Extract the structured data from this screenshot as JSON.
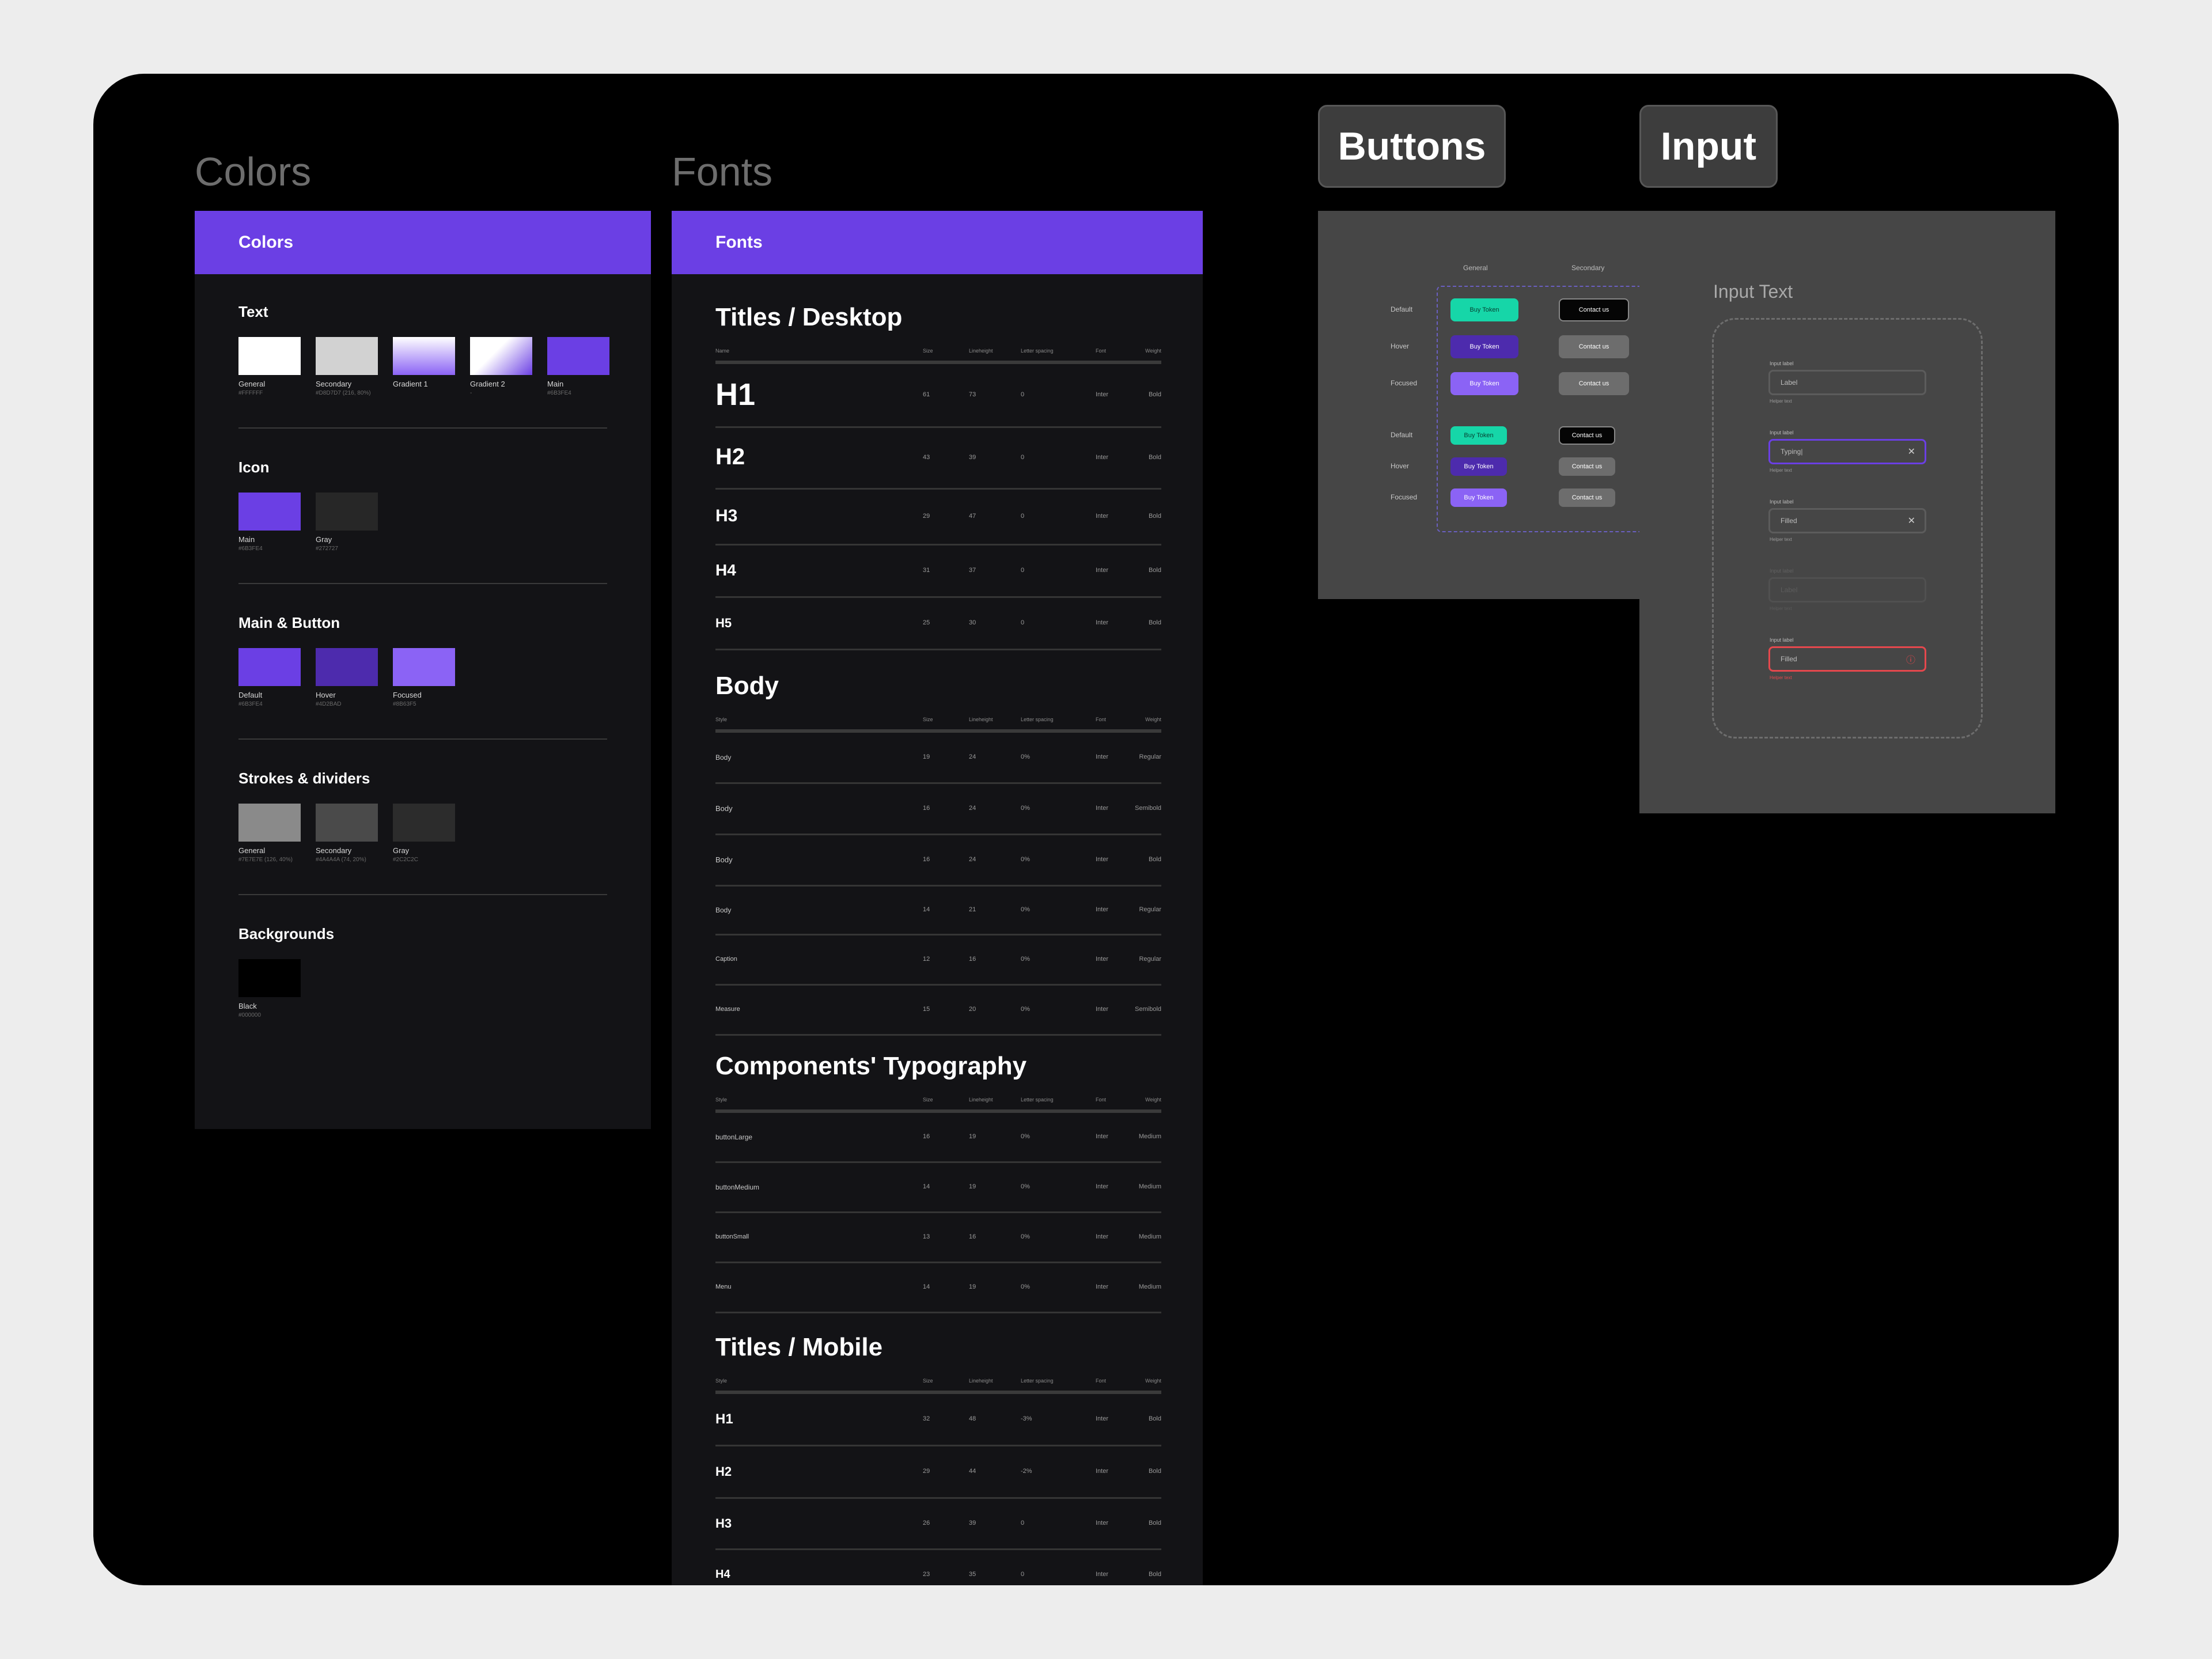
{
  "sections": {
    "colors": "Colors",
    "fonts": "Fonts",
    "buttons": "Buttons",
    "input": "Input"
  },
  "colors_frame": {
    "header": "Colors",
    "groups": [
      {
        "title": "Text",
        "swatches": [
          {
            "name": "General",
            "hex": "#FFFFFF",
            "color": "#ffffff"
          },
          {
            "name": "Secondary",
            "hex": "#D8D7D7 (216, 80%)",
            "color": "#d2d2d2"
          },
          {
            "name": "Gradient 1",
            "hex": "",
            "color": "linear-gradient(180deg,#ffffff 0%,#8b63f5 100%)"
          },
          {
            "name": "Gradient 2",
            "hex": "-",
            "color": "linear-gradient(135deg,#ffffff 0%,#ffffff 40%,#6b3fe4 100%)"
          },
          {
            "name": "Main",
            "hex": "#6B3FE4",
            "color": "#6b3fe4"
          }
        ]
      },
      {
        "title": "Icon",
        "swatches": [
          {
            "name": "Main",
            "hex": "#6B3FE4",
            "color": "#6b3fe4"
          },
          {
            "name": "Gray",
            "hex": "#272727",
            "color": "#272727"
          }
        ]
      },
      {
        "title": "Main & Button",
        "swatches": [
          {
            "name": "Default",
            "hex": "#6B3FE4",
            "color": "#6b3fe4"
          },
          {
            "name": "Hover",
            "hex": "#4D2BAD",
            "color": "#4d2bad"
          },
          {
            "name": "Focused",
            "hex": "#8B63F5",
            "color": "#8b63f5"
          }
        ]
      },
      {
        "title": "Strokes & dividers",
        "swatches": [
          {
            "name": "General",
            "hex": "#7E7E7E (126, 40%)",
            "color": "#8a8a8a"
          },
          {
            "name": "Secondary",
            "hex": "#4A4A4A (74, 20%)",
            "color": "#4a4a4a"
          },
          {
            "name": "Gray",
            "hex": "#2C2C2C",
            "color": "#2c2c2c"
          }
        ]
      },
      {
        "title": "Backgrounds",
        "swatches": [
          {
            "name": "Black",
            "hex": "#000000",
            "color": "#000000"
          }
        ]
      }
    ]
  },
  "fonts_frame": {
    "header": "Fonts",
    "sections": [
      {
        "title": "Titles / Desktop",
        "headers": [
          "Name",
          "Size",
          "Lineheight",
          "Letter spacing",
          "Font",
          "Weight"
        ],
        "rows": [
          {
            "name": "H1",
            "size": "61",
            "lh": "73",
            "ls": "0",
            "font": "Inter",
            "weight": "Bold"
          },
          {
            "name": "H2",
            "size": "43",
            "lh": "39",
            "ls": "0",
            "font": "Inter",
            "weight": "Bold"
          },
          {
            "name": "H3",
            "size": "29",
            "lh": "47",
            "ls": "0",
            "font": "Inter",
            "weight": "Bold"
          },
          {
            "name": "H4",
            "size": "31",
            "lh": "37",
            "ls": "0",
            "font": "Inter",
            "weight": "Bold"
          },
          {
            "name": "H5",
            "size": "25",
            "lh": "30",
            "ls": "0",
            "font": "Inter",
            "weight": "Bold"
          }
        ]
      },
      {
        "title": "Body",
        "headers": [
          "Style",
          "Size",
          "Lineheight",
          "Letter spacing",
          "Font",
          "Weight"
        ],
        "rows": [
          {
            "name": "Body",
            "size": "19",
            "lh": "24",
            "ls": "0%",
            "font": "Inter",
            "weight": "Regular"
          },
          {
            "name": "Body",
            "size": "16",
            "lh": "24",
            "ls": "0%",
            "font": "Inter",
            "weight": "Semibold"
          },
          {
            "name": "Body",
            "size": "16",
            "lh": "24",
            "ls": "0%",
            "font": "Inter",
            "weight": "Bold"
          },
          {
            "name": "Body",
            "size": "14",
            "lh": "21",
            "ls": "0%",
            "font": "Inter",
            "weight": "Regular"
          },
          {
            "name": "Caption",
            "size": "12",
            "lh": "16",
            "ls": "0%",
            "font": "Inter",
            "weight": "Regular"
          },
          {
            "name": "Measure",
            "size": "15",
            "lh": "20",
            "ls": "0%",
            "font": "Inter",
            "weight": "Semibold"
          }
        ]
      },
      {
        "title": "Components' Typography",
        "headers": [
          "Style",
          "Size",
          "Lineheight",
          "Letter spacing",
          "Font",
          "Weight"
        ],
        "rows": [
          {
            "name": "buttonLarge",
            "size": "16",
            "lh": "19",
            "ls": "0%",
            "font": "Inter",
            "weight": "Medium"
          },
          {
            "name": "buttonMedium",
            "size": "14",
            "lh": "19",
            "ls": "0%",
            "font": "Inter",
            "weight": "Medium"
          },
          {
            "name": "buttonSmall",
            "size": "13",
            "lh": "16",
            "ls": "0%",
            "font": "Inter",
            "weight": "Medium"
          },
          {
            "name": "Menu",
            "size": "14",
            "lh": "19",
            "ls": "0%",
            "font": "Inter",
            "weight": "Medium"
          }
        ]
      },
      {
        "title": "Titles / Mobile",
        "headers": [
          "Style",
          "Size",
          "Lineheight",
          "Letter spacing",
          "Font",
          "Weight"
        ],
        "rows": [
          {
            "name": "H1",
            "size": "32",
            "lh": "48",
            "ls": "-3%",
            "font": "Inter",
            "weight": "Bold"
          },
          {
            "name": "H2",
            "size": "29",
            "lh": "44",
            "ls": "-2%",
            "font": "Inter",
            "weight": "Bold"
          },
          {
            "name": "H3",
            "size": "26",
            "lh": "39",
            "ls": "0",
            "font": "Inter",
            "weight": "Bold"
          },
          {
            "name": "H4",
            "size": "23",
            "lh": "35",
            "ls": "0",
            "font": "Inter",
            "weight": "Bold"
          }
        ]
      }
    ]
  },
  "buttons_frame": {
    "col_general": "General",
    "col_secondary": "Secondary",
    "rows_large": [
      "Default",
      "Hover",
      "Focused"
    ],
    "rows_small": [
      "Default",
      "Hover",
      "Focused"
    ],
    "primary_label": "Buy Token",
    "secondary_label": "Contact us",
    "colors": {
      "default": "#16d6a8",
      "hover": "#4d2bad",
      "focused": "#8b63f5",
      "secondary_default": "#050505",
      "secondary_other": "#6d6d6d"
    }
  },
  "input_frame": {
    "title": "Input Text",
    "fields": [
      {
        "label": "Input label",
        "value": "Label",
        "helper": "Helper text",
        "state": "default",
        "icon": ""
      },
      {
        "label": "Input label",
        "value": "Typing|",
        "helper": "Helper text",
        "state": "focused",
        "icon": "✕"
      },
      {
        "label": "Input label",
        "value": "Filled",
        "helper": "Helper text",
        "state": "filled",
        "icon": "✕"
      },
      {
        "label": "Input label",
        "value": "Label",
        "helper": "Helper text",
        "state": "disabled",
        "icon": ""
      },
      {
        "label": "Input label",
        "value": "Filled",
        "helper": "Helper text",
        "state": "error",
        "icon": "ⓘ"
      }
    ]
  }
}
